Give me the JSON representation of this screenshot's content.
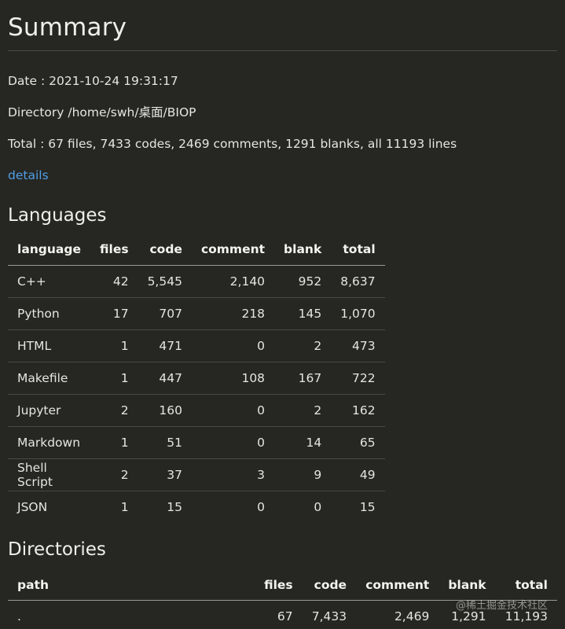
{
  "summary": {
    "title": "Summary",
    "date_line": "Date : 2021-10-24 19:31:17",
    "directory_line": "Directory /home/swh/桌面/BIOP",
    "total_line": "Total : 67 files,  7433 codes, 2469 comments, 1291 blanks, all 11193 lines",
    "details_link": "details"
  },
  "languages": {
    "heading": "Languages",
    "columns": [
      "language",
      "files",
      "code",
      "comment",
      "blank",
      "total"
    ],
    "rows": [
      [
        "C++",
        "42",
        "5,545",
        "2,140",
        "952",
        "8,637"
      ],
      [
        "Python",
        "17",
        "707",
        "218",
        "145",
        "1,070"
      ],
      [
        "HTML",
        "1",
        "471",
        "0",
        "2",
        "473"
      ],
      [
        "Makefile",
        "1",
        "447",
        "108",
        "167",
        "722"
      ],
      [
        "Jupyter",
        "2",
        "160",
        "0",
        "2",
        "162"
      ],
      [
        "Markdown",
        "1",
        "51",
        "0",
        "14",
        "65"
      ],
      [
        "Shell Script",
        "2",
        "37",
        "3",
        "9",
        "49"
      ],
      [
        "JSON",
        "1",
        "15",
        "0",
        "0",
        "15"
      ]
    ]
  },
  "directories": {
    "heading": "Directories",
    "columns": [
      "path",
      "files",
      "code",
      "comment",
      "blank",
      "total"
    ],
    "rows": [
      [
        ".",
        "67",
        "7,433",
        "2,469",
        "1,291",
        "11,193"
      ]
    ]
  },
  "watermark": "@稀土掘金技术社区",
  "colors": {
    "background": "#262622",
    "text": "#e6e6e0",
    "link": "#4f9fe6",
    "rule": "#4a4a44"
  }
}
